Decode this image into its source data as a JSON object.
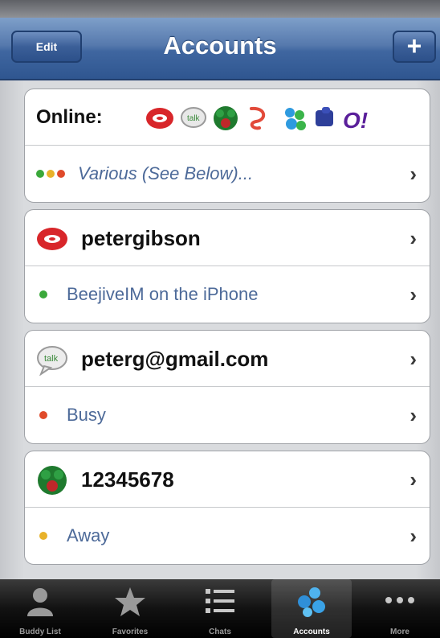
{
  "nav": {
    "edit_label": "Edit",
    "title": "Accounts",
    "add_label": "+"
  },
  "summary": {
    "online_label": "Online:",
    "services": [
      "aim-icon",
      "google-talk-icon",
      "icq-icon",
      "jabber-icon",
      "msn-icon",
      "myspace-icon",
      "yahoo-icon"
    ],
    "status_text": "Various (See Below)..."
  },
  "accounts": [
    {
      "service_icon": "aim-icon",
      "name": "petergibson",
      "status": "BeejiveIM on the iPhone",
      "status_color": "#3aa83a"
    },
    {
      "service_icon": "google-talk-icon",
      "name": "peterg@gmail.com",
      "status": "Busy",
      "status_color": "#e04a2a"
    },
    {
      "service_icon": "icq-icon",
      "name": "12345678",
      "status": "Away",
      "status_color": "#e8b22a"
    }
  ],
  "tabs": [
    {
      "label": "Buddy List",
      "icon": "buddy-icon"
    },
    {
      "label": "Favorites",
      "icon": "star-icon"
    },
    {
      "label": "Chats",
      "icon": "chats-icon"
    },
    {
      "label": "Accounts",
      "icon": "accounts-icon",
      "selected": true
    },
    {
      "label": "More",
      "icon": "more-icon"
    }
  ]
}
